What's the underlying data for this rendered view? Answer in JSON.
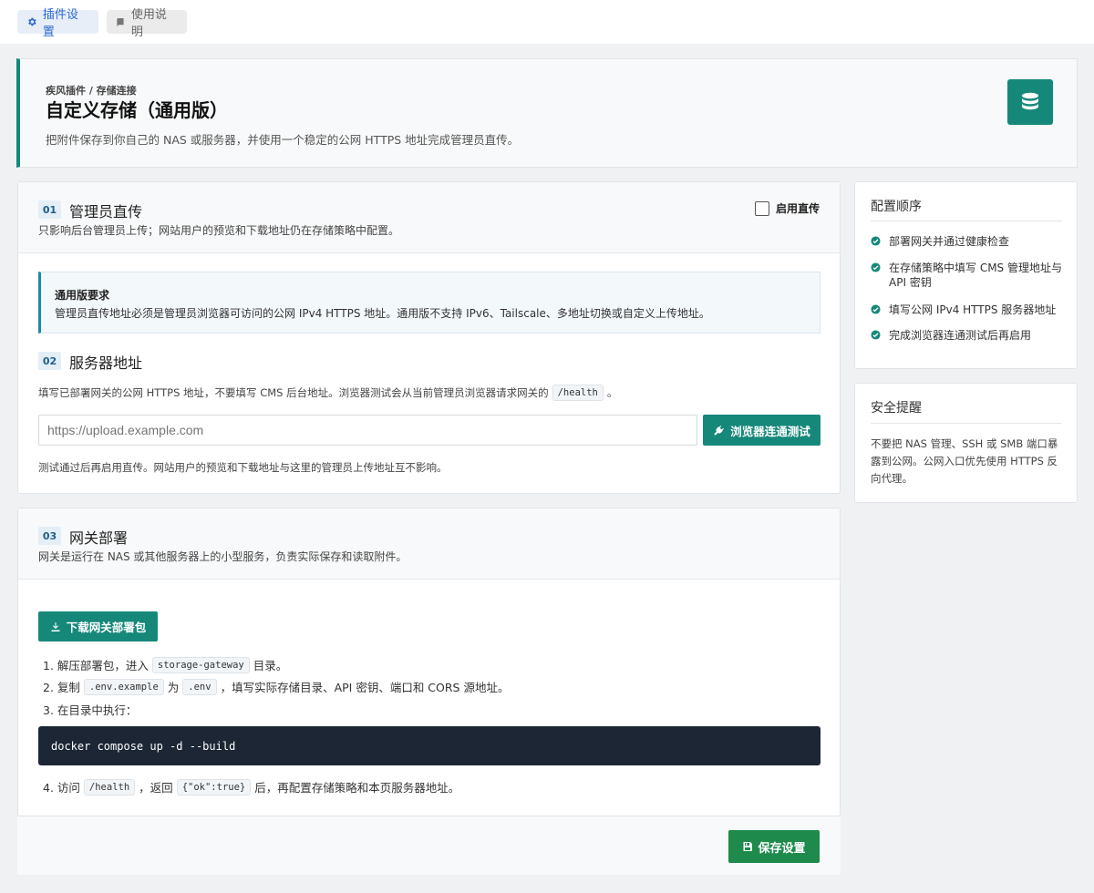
{
  "tabs": [
    {
      "label": "插件设置"
    },
    {
      "label": "使用说明"
    }
  ],
  "header": {
    "breadcrumb": "疾风插件 / 存储连接",
    "title": "自定义存储（通用版）",
    "description": "把附件保存到你自己的 NAS 或服务器，并使用一个稳定的公网 HTTPS 地址完成管理员直传。"
  },
  "section1": {
    "number": "01",
    "title": "管理员直传",
    "subtitle": "只影响后台管理员上传；网站用户的预览和下载地址仍在存储策略中配置。",
    "toggle_label": "启用直传",
    "notice_title": "通用版要求",
    "notice_text": "管理员直传地址必须是管理员浏览器可访问的公网 IPv4 HTTPS 地址。通用版不支持 IPv6、Tailscale、多地址切换或自定义上传地址。"
  },
  "section2": {
    "number": "02",
    "title": "服务器地址",
    "hint_before": "填写已部署网关的公网 HTTPS 地址，不要填写 CMS 后台地址。浏览器测试会从当前管理员浏览器请求网关的",
    "hint_code": "/health",
    "hint_after": "。",
    "input_placeholder": "https://upload.example.com",
    "test_button": "浏览器连通测试",
    "footnote": "测试通过后再启用直传。网站用户的预览和下载地址与这里的管理员上传地址互不影响。"
  },
  "section3": {
    "number": "03",
    "title": "网关部署",
    "subtitle": "网关是运行在 NAS 或其他服务器上的小型服务，负责实际保存和读取附件。",
    "download_button": "下载网关部署包",
    "step1_a": "1. 解压部署包，进入",
    "step1_code": "storage-gateway",
    "step1_b": "目录。",
    "step2_a": "2. 复制",
    "step2_code1": ".env.example",
    "step2_b": "为",
    "step2_code2": ".env",
    "step2_c": "，填写实际存储目录、API 密钥、端口和 CORS 源地址。",
    "step3": "3. 在目录中执行：",
    "command": "docker compose up -d --build",
    "step4_a": "4. 访问",
    "step4_code1": "/health",
    "step4_b": "，返回",
    "step4_code2": "{\"ok\":true}",
    "step4_c": "后，再配置存储策略和本页服务器地址。"
  },
  "footer": {
    "save_button": "保存设置"
  },
  "sidebar": {
    "order_title": "配置顺序",
    "order_items": [
      "部署网关并通过健康检查",
      "在存储策略中填写 CMS 管理地址与 API 密钥",
      "填写公网 IPv4 HTTPS 服务器地址",
      "完成浏览器连通测试后再启用"
    ],
    "safety_title": "安全提醒",
    "safety_text": "不要把 NAS 管理、SSH 或 SMB 端口暴露到公网。公网入口优先使用 HTTPS 反向代理。"
  },
  "colors": {
    "accent": "#16887a",
    "save": "#1e8a4c",
    "link": "#2c6ad4",
    "terminal": "#1c2634"
  },
  "icons": [
    "gear-icon",
    "book-icon",
    "database-icon",
    "plug-icon",
    "download-icon",
    "save-icon",
    "check-circle-icon"
  ]
}
